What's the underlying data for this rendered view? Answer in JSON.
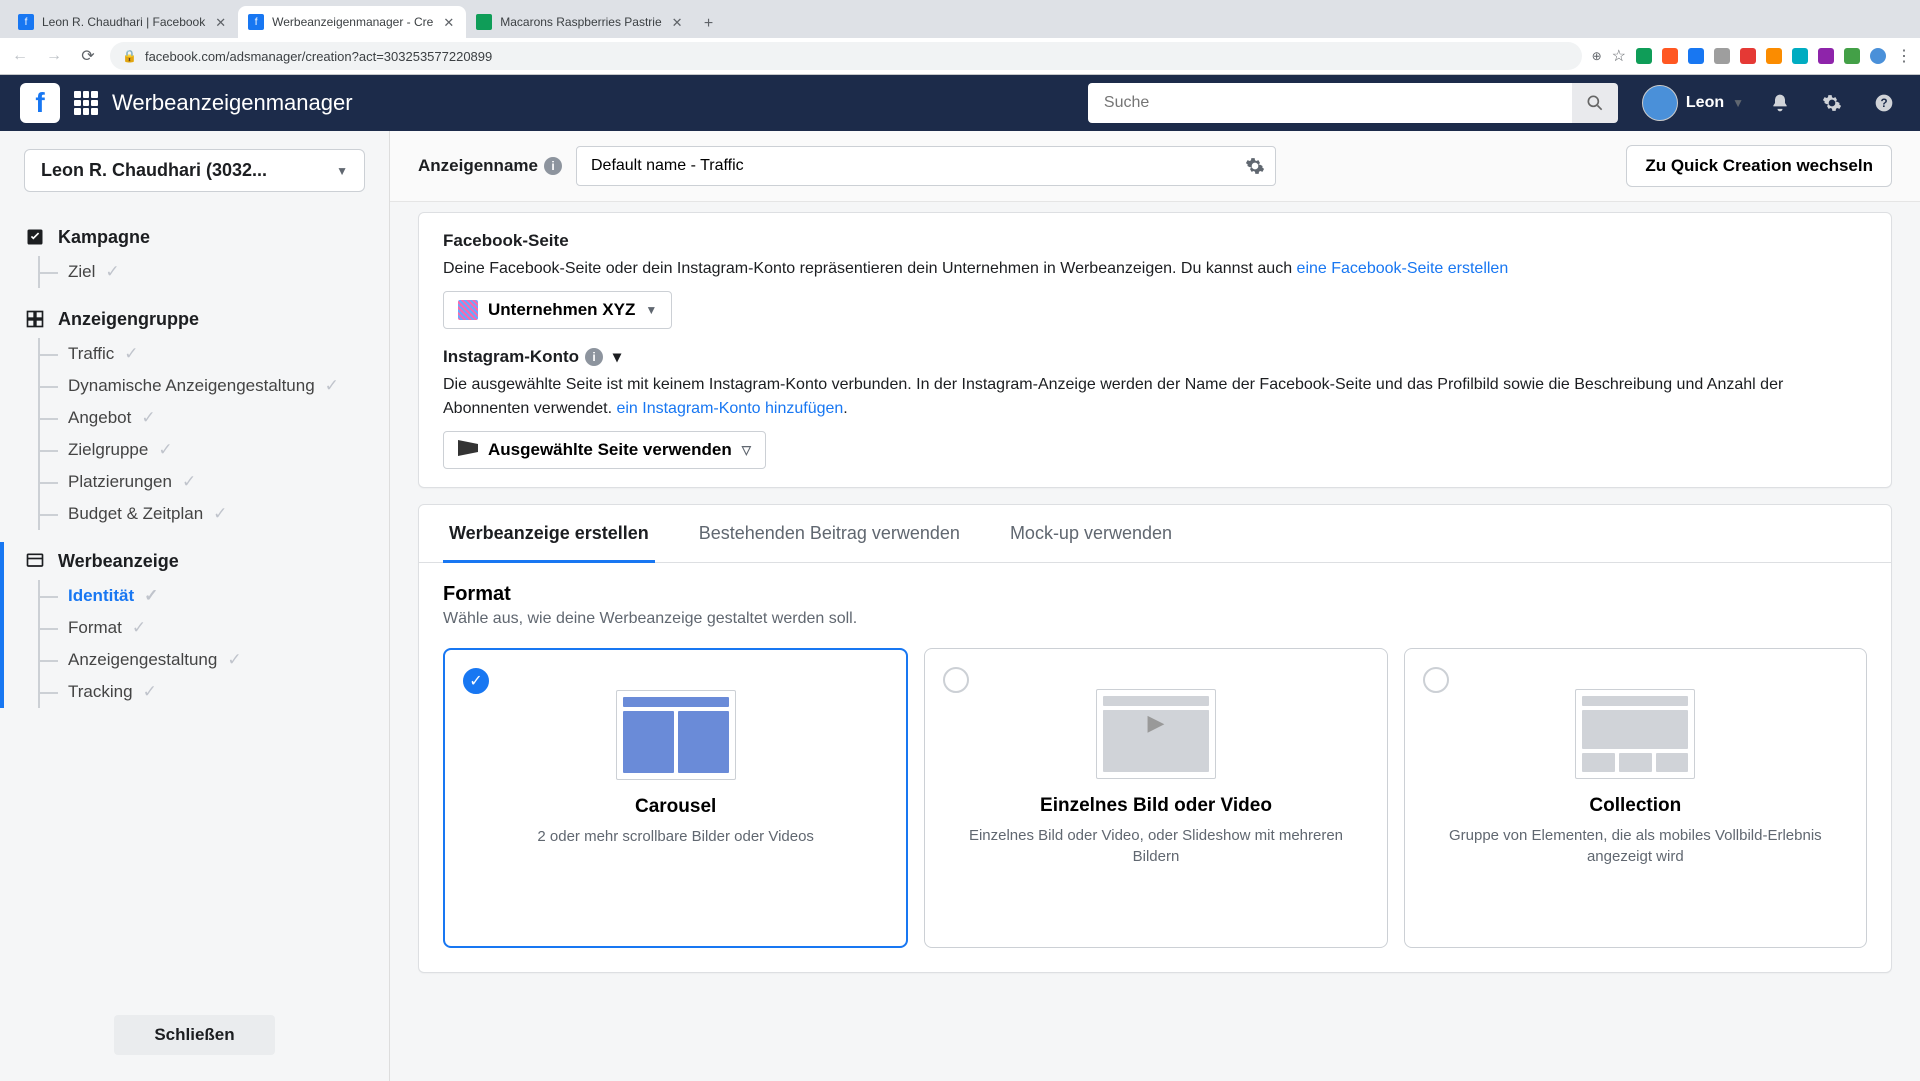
{
  "browser": {
    "tabs": [
      {
        "title": "Leon R. Chaudhari | Facebook",
        "favicon_bg": "#1877f2",
        "favicon_text": "f",
        "favicon_color": "#fff"
      },
      {
        "title": "Werbeanzeigenmanager - Cre",
        "favicon_bg": "#1877f2",
        "favicon_text": "f",
        "favicon_color": "#fff"
      },
      {
        "title": "Macarons Raspberries Pastrie",
        "favicon_bg": "#0f9d58",
        "favicon_text": "",
        "favicon_color": "#fff"
      }
    ],
    "url": "facebook.com/adsmanager/creation?act=303253577220899"
  },
  "header": {
    "app_title": "Werbeanzeigenmanager",
    "search_placeholder": "Suche",
    "user_name": "Leon"
  },
  "sidebar": {
    "account_label": "Leon R. Chaudhari (3032...",
    "section_campaign": "Kampagne",
    "campaign_items": [
      "Ziel"
    ],
    "section_adset": "Anzeigengruppe",
    "adset_items": [
      "Traffic",
      "Dynamische Anzeigengestaltung",
      "Angebot",
      "Zielgruppe",
      "Platzierungen",
      "Budget & Zeitplan"
    ],
    "section_ad": "Werbeanzeige",
    "ad_items": [
      "Identität",
      "Format",
      "Anzeigengestaltung",
      "Tracking"
    ],
    "close": "Schließen"
  },
  "topbar": {
    "name_label": "Anzeigenname",
    "name_value": "Default name - Traffic",
    "quick_label": "Zu Quick Creation wechseln"
  },
  "identity": {
    "fb_page_heading": "Facebook-Seite",
    "fb_page_text_1": "Deine Facebook-Seite oder dein Instagram-Konto repräsentieren dein Unternehmen in Werbeanzeigen. Du kannst auch ",
    "fb_page_link": "eine Facebook-Seite erstellen",
    "page_selector": "Unternehmen XYZ",
    "ig_heading": "Instagram-Konto",
    "ig_text_1": "Die ausgewählte Seite ist mit keinem Instagram-Konto verbunden. In der Instagram-Anzeige werden der Name der Facebook-Seite und das Profilbild sowie die Beschreibung und Anzahl der Abonnenten verwendet. ",
    "ig_link": "ein Instagram-Konto hinzufügen",
    "ig_text_2": ".",
    "ig_selector": "Ausgewählte Seite verwenden"
  },
  "tabs": {
    "create": "Werbeanzeige erstellen",
    "existing": "Bestehenden Beitrag verwenden",
    "mockup": "Mock-up verwenden"
  },
  "format": {
    "heading": "Format",
    "sub": "Wähle aus, wie deine Werbeanzeige gestaltet werden soll.",
    "options": [
      {
        "title": "Carousel",
        "desc": "2 oder mehr scrollbare Bilder oder Videos"
      },
      {
        "title": "Einzelnes Bild oder Video",
        "desc": "Einzelnes Bild oder Video, oder Slideshow mit mehreren Bildern"
      },
      {
        "title": "Collection",
        "desc": "Gruppe von Elementen, die als mobiles Vollbild-Erlebnis angezeigt wird"
      }
    ]
  }
}
